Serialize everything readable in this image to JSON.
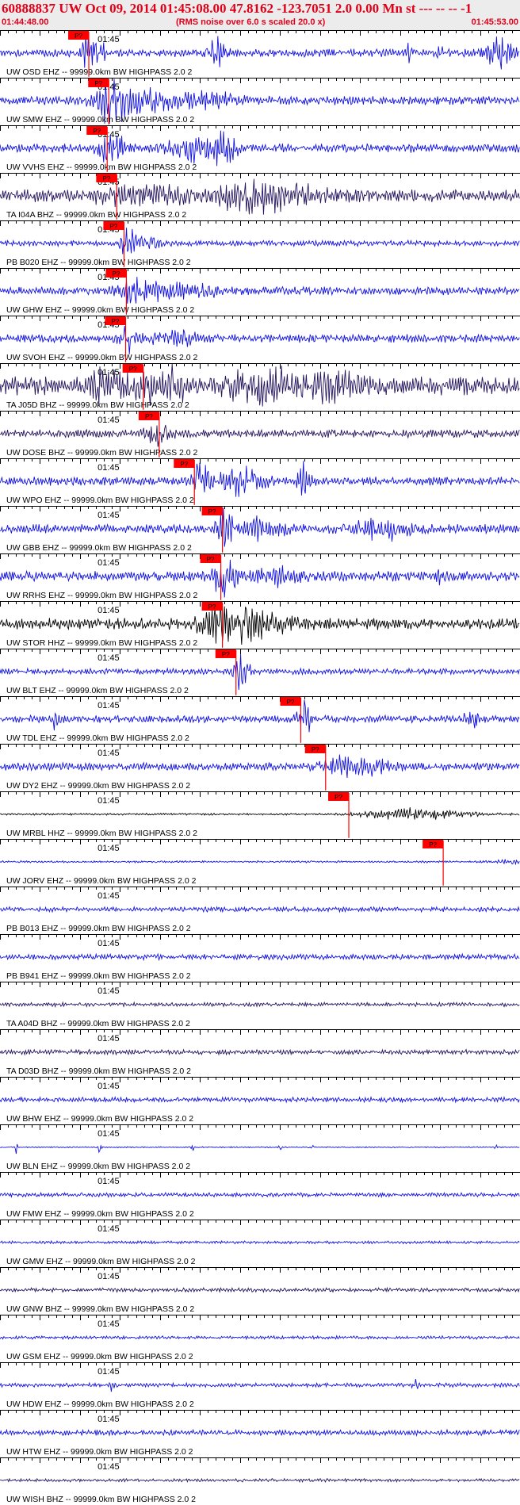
{
  "header": {
    "title": "60888837 UW Oct 09, 2014 01:45:08.00   47.8162 -123.7051  2.0 0.00 Mn st --- -- --   -1",
    "start_time": "01:44:48.00",
    "noise_note": "(RMS noise over 6.0 s scaled 20.0 x)",
    "end_time": "01:45:53.00"
  },
  "colors": {
    "background": "#ffffff",
    "header": "#ececec",
    "text": "#e0001a",
    "pick": "#ff0000",
    "blue": "#1010e0",
    "navy": "#25145e",
    "black": "#000000"
  },
  "chart_data": {
    "type": "seismogram",
    "start_time": "01:44:48.00",
    "end_time": "01:45:53.00",
    "duration_s": 65,
    "tick_label": "01:45",
    "tick_label_time_s": 12,
    "tick_interval_s": 1,
    "pick_label": "P?",
    "traces": [
      {
        "label": "UW OSD EHZ -- 99999.0km BW  HIGHPASS  2.0  2",
        "color": "blue",
        "noise": 0.2,
        "pick_s": 11.1,
        "events": [
          [
            11.5,
            1.0,
            1.5
          ],
          [
            27.0,
            0.8,
            1.3
          ],
          [
            51.0,
            0.45,
            0.5
          ],
          [
            55.0,
            0.4,
            0.5
          ],
          [
            62.5,
            1.0,
            1.3
          ]
        ]
      },
      {
        "label": "UW SMW EHZ -- 99999.0km BW  HIGHPASS  2.0  2",
        "color": "blue",
        "noise": 0.22,
        "pick_s": 13.6,
        "events": [
          [
            14.0,
            0.95,
            2.0
          ],
          [
            18.0,
            0.5,
            4.0
          ],
          [
            26.0,
            0.35,
            3.0
          ]
        ]
      },
      {
        "label": "UW VVHS EHZ -- 99999.0km BW  HIGHPASS  2.0  2",
        "color": "blue",
        "noise": 0.22,
        "pick_s": 13.4,
        "events": [
          [
            14.0,
            0.9,
            1.5
          ],
          [
            24.0,
            0.55,
            3.0
          ],
          [
            28.0,
            0.75,
            1.5
          ]
        ]
      },
      {
        "label": "TA I04A BHZ -- 99999.0km BW  HIGHPASS  2.0  2",
        "color": "navy",
        "noise": 0.3,
        "pick_s": 14.6,
        "events": [
          [
            18.0,
            0.35,
            6.0
          ],
          [
            30.0,
            0.55,
            4.0
          ],
          [
            36.0,
            0.4,
            5.0
          ]
        ]
      },
      {
        "label": "PB B020 EHZ -- 99999.0km BW  HIGHPASS  2.0  2",
        "color": "blue",
        "noise": 0.14,
        "pick_s": 15.5,
        "events": [
          [
            16.0,
            0.75,
            0.8
          ],
          [
            18.0,
            0.3,
            2.0
          ]
        ]
      },
      {
        "label": "UW GHW EHZ -- 99999.0km BW  HIGHPASS  2.0  2",
        "color": "blue",
        "noise": 0.2,
        "pick_s": 15.8,
        "events": [
          [
            17.0,
            0.55,
            2.0
          ],
          [
            22.0,
            0.35,
            5.0
          ]
        ]
      },
      {
        "label": "UW SVOH EHZ -- 99999.0km BW  HIGHPASS  2.0  2",
        "color": "blue",
        "noise": 0.2,
        "pick_s": 15.7,
        "events": [
          [
            16.0,
            0.55,
            1.0
          ],
          [
            22.0,
            0.3,
            3.0
          ]
        ]
      },
      {
        "label": "TA J05D BHZ -- 99999.0km BW  HIGHPASS  2.0  2",
        "color": "navy",
        "noise": 0.45,
        "pick_s": 17.9,
        "events": [
          [
            13.0,
            0.55,
            2.0
          ],
          [
            20.0,
            0.95,
            3.0
          ],
          [
            33.0,
            1.0,
            3.5
          ],
          [
            42.0,
            0.55,
            3.0
          ]
        ]
      },
      {
        "label": "UW DOSE BHZ -- 99999.0km BW  HIGHPASS  2.0  2",
        "color": "navy",
        "noise": 0.2,
        "pick_s": 19.9,
        "events": [
          [
            20.0,
            0.55,
            1.5
          ]
        ]
      },
      {
        "label": "UW WPO EHZ -- 99999.0km BW  HIGHPASS  2.0  2",
        "color": "blue",
        "noise": 0.22,
        "pick_s": 24.3,
        "events": [
          [
            25.0,
            0.8,
            1.0
          ],
          [
            30.0,
            0.6,
            3.0
          ],
          [
            38.0,
            0.85,
            0.8
          ]
        ]
      },
      {
        "label": "UW GBB EHZ -- 99999.0km BW  HIGHPASS  2.0  2",
        "color": "blue",
        "noise": 0.22,
        "pick_s": 27.8,
        "events": [
          [
            28.0,
            0.9,
            1.0
          ],
          [
            32.0,
            0.55,
            3.0
          ],
          [
            48.0,
            0.45,
            4.0
          ]
        ]
      },
      {
        "label": "UW RRHS EHZ -- 99999.0km BW  HIGHPASS  2.0  2",
        "color": "blue",
        "noise": 0.25,
        "pick_s": 27.6,
        "events": [
          [
            28.0,
            0.85,
            1.5
          ],
          [
            35.0,
            0.4,
            3.0
          ],
          [
            55.0,
            0.6,
            0.3
          ]
        ]
      },
      {
        "label": "UW STOR HHZ -- 99999.0km BW  HIGHPASS  2.0  2",
        "color": "black",
        "noise": 0.28,
        "pick_s": 27.8,
        "events": [
          [
            28.0,
            1.0,
            2.5
          ],
          [
            32.0,
            0.6,
            4.0
          ]
        ]
      },
      {
        "label": "UW BLT EHZ -- 99999.0km BW  HIGHPASS  2.0  2",
        "color": "blue",
        "noise": 0.14,
        "pick_s": 29.5,
        "events": [
          [
            30.0,
            1.0,
            1.0
          ]
        ]
      },
      {
        "label": "UW TDL EHZ -- 99999.0km BW  HIGHPASS  2.0  2",
        "color": "blue",
        "noise": 0.18,
        "pick_s": 37.6,
        "events": [
          [
            7.0,
            0.5,
            0.5
          ],
          [
            38.0,
            0.9,
            0.8
          ],
          [
            59.0,
            0.5,
            0.8
          ]
        ]
      },
      {
        "label": "UW DY2 EHZ -- 99999.0km BW  HIGHPASS  2.0  2",
        "color": "blue",
        "noise": 0.2,
        "pick_s": 40.7,
        "events": [
          [
            42.0,
            0.55,
            1.5
          ],
          [
            46.0,
            0.3,
            3.0
          ]
        ]
      },
      {
        "label": "UW MRBL HHZ -- 99999.0km BW  HIGHPASS  2.0  2",
        "color": "black",
        "noise": 0.05,
        "pick_s": 43.6,
        "events": [
          [
            52.0,
            0.3,
            6.0
          ]
        ]
      },
      {
        "label": "UW JORV EHZ -- 99999.0km BW  HIGHPASS  2.0  2",
        "color": "blue",
        "noise": 0.05,
        "pick_s": 55.4,
        "events": [
          [
            64.0,
            0.12,
            2.0
          ]
        ]
      },
      {
        "label": "PB B013 EHZ -- 99999.0km BW  HIGHPASS  2.0  2",
        "color": "blue",
        "noise": 0.12,
        "pick_s": null,
        "events": []
      },
      {
        "label": "PB B941 EHZ -- 99999.0km BW  HIGHPASS  2.0  2",
        "color": "blue",
        "noise": 0.14,
        "pick_s": null,
        "events": []
      },
      {
        "label": "TA A04D BHZ -- 99999.0km BW  HIGHPASS  2.0  2",
        "color": "navy",
        "noise": 0.1,
        "pick_s": null,
        "events": []
      },
      {
        "label": "TA D03D BHZ -- 99999.0km BW  HIGHPASS  2.0  2",
        "color": "navy",
        "noise": 0.12,
        "pick_s": null,
        "events": []
      },
      {
        "label": "UW BHW EHZ -- 99999.0km BW  HIGHPASS  2.0  2",
        "color": "blue",
        "noise": 0.12,
        "pick_s": null,
        "events": []
      },
      {
        "label": "UW BLN EHZ -- 99999.0km BW  HIGHPASS  2.0  2",
        "color": "blue",
        "noise": 0.03,
        "pick_s": null,
        "events": [
          [
            2.0,
            0.4,
            0.15
          ],
          [
            12.5,
            0.5,
            0.15
          ],
          [
            24.0,
            0.45,
            0.15
          ],
          [
            35.0,
            0.3,
            0.15
          ],
          [
            39.0,
            0.35,
            0.15
          ],
          [
            62.0,
            0.3,
            0.15
          ]
        ]
      },
      {
        "label": "UW FMW EHZ -- 99999.0km BW  HIGHPASS  2.0  2",
        "color": "blue",
        "noise": 0.1,
        "pick_s": null,
        "events": []
      },
      {
        "label": "UW GMW EHZ -- 99999.0km BW  HIGHPASS  2.0  2",
        "color": "blue",
        "noise": 0.07,
        "pick_s": null,
        "events": []
      },
      {
        "label": "UW GNW BHZ -- 99999.0km BW  HIGHPASS  2.0  2",
        "color": "navy",
        "noise": 0.1,
        "pick_s": null,
        "events": []
      },
      {
        "label": "UW GSM EHZ -- 99999.0km BW  HIGHPASS  2.0  2",
        "color": "blue",
        "noise": 0.08,
        "pick_s": null,
        "events": []
      },
      {
        "label": "UW HDW EHZ -- 99999.0km BW  HIGHPASS  2.0  2",
        "color": "blue",
        "noise": 0.1,
        "pick_s": null,
        "events": [
          [
            14.0,
            0.3,
            0.4
          ],
          [
            52.0,
            0.3,
            0.4
          ]
        ]
      },
      {
        "label": "UW HTW EHZ -- 99999.0km BW  HIGHPASS  2.0  2",
        "color": "blue",
        "noise": 0.14,
        "pick_s": null,
        "events": []
      },
      {
        "label": "UW WISH BHZ -- 99999.0km BW  HIGHPASS  2.0  2",
        "color": "navy",
        "noise": 0.08,
        "pick_s": null,
        "events": []
      }
    ]
  }
}
